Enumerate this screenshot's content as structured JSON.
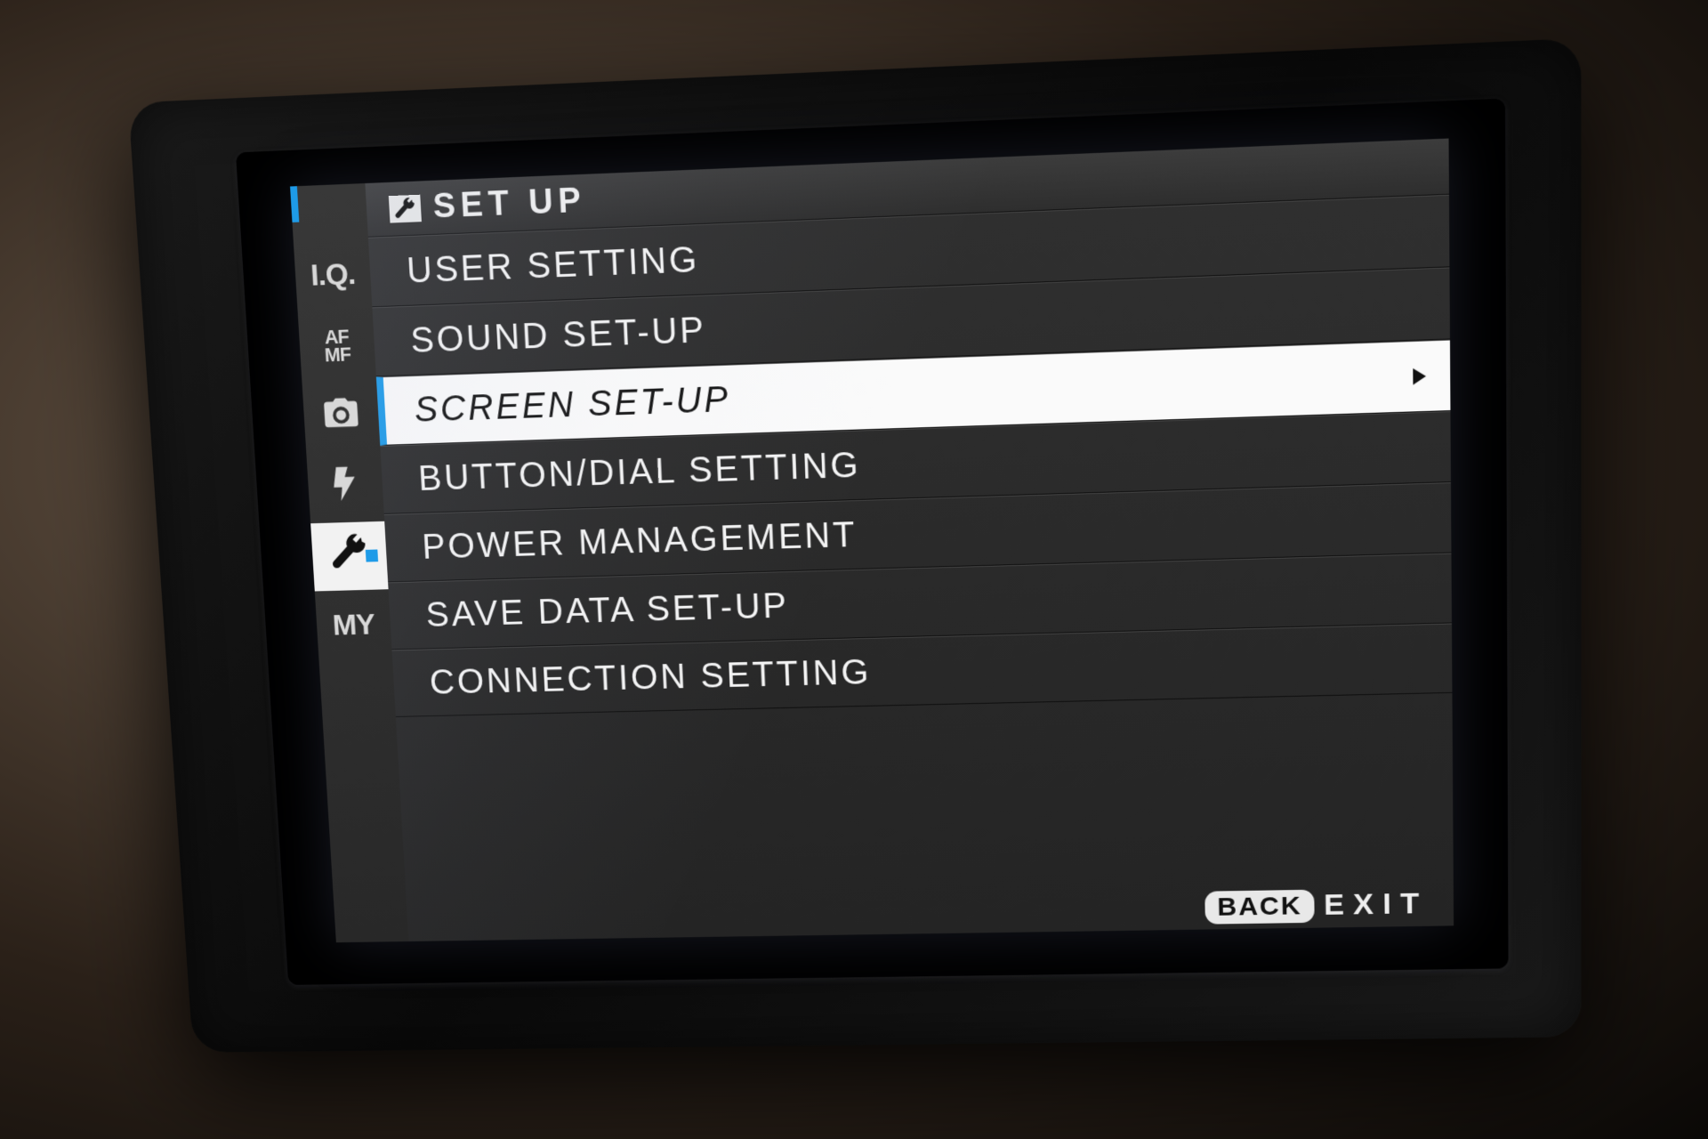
{
  "header": {
    "title": "SET UP"
  },
  "sidebar": {
    "tabs": [
      {
        "id": "iq",
        "label": "I.Q."
      },
      {
        "id": "afmf",
        "label_top": "AF",
        "label_bot": "MF"
      },
      {
        "id": "shoot",
        "icon": "camera"
      },
      {
        "id": "flash",
        "icon": "bolt"
      },
      {
        "id": "setup",
        "icon": "wrench",
        "selected": true
      },
      {
        "id": "my",
        "label": "MY"
      }
    ]
  },
  "menu": {
    "items": [
      {
        "label": "USER SETTING"
      },
      {
        "label": "SOUND SET-UP"
      },
      {
        "label": "SCREEN SET-UP",
        "selected": true
      },
      {
        "label": "BUTTON/DIAL SETTING"
      },
      {
        "label": "POWER MANAGEMENT"
      },
      {
        "label": "SAVE DATA SET-UP"
      },
      {
        "label": "CONNECTION SETTING"
      }
    ]
  },
  "footer": {
    "back": "BACK",
    "exit": "EXIT"
  }
}
